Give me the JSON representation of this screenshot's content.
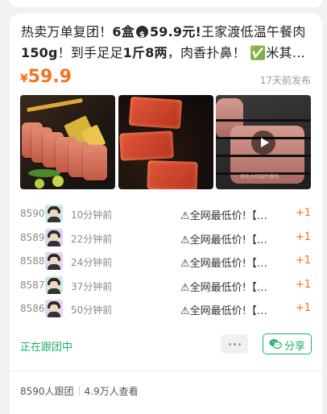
{
  "post": {
    "title_parts": {
      "t1": "热卖万单复团！",
      "t2": "6盒",
      "t3": "59.9元",
      "t4": "!",
      "t5": "王家渡低温午餐肉",
      "t6": "150g",
      "t7": "！到手足足",
      "t8": "1斤8两",
      "t9": "，肉香扑鼻！ ✅米其…"
    },
    "price_symbol": "¥",
    "price_value": "59.9",
    "posted_time": "17天前发布",
    "photos": [
      {
        "name": "luncheon-meat-slices-photo"
      },
      {
        "name": "fried-luncheon-meat-photo"
      },
      {
        "name": "grilled-luncheon-meat-video"
      }
    ],
    "video_watermark": "现在小红园午餐肉"
  },
  "followers": [
    {
      "number": "8590",
      "time": "10分钟前",
      "message": "⚠全网最低价!【…",
      "plus": "+1",
      "avatar_bg": "#cfe9e0"
    },
    {
      "number": "8589",
      "time": "22分钟前",
      "message": "⚠全网最低价!【…",
      "plus": "+1",
      "avatar_bg": "#dcd5ef"
    },
    {
      "number": "8588",
      "time": "24分钟前",
      "message": "⚠全网最低价!【…",
      "plus": "+1",
      "avatar_bg": "#e6d3ec"
    },
    {
      "number": "8587",
      "time": "37分钟前",
      "message": "⚠全网最低价!【…",
      "plus": "+1",
      "avatar_bg": "#cfe9e0"
    },
    {
      "number": "8586",
      "time": "50分钟前",
      "message": "⚠全网最低价!【…",
      "plus": "+1",
      "avatar_bg": "#e6d3ec"
    }
  ],
  "actions": {
    "following_label": "正在跟团中",
    "more_icon": "more-dots-icon",
    "share_label": "分享",
    "share_icon": "wechat-icon"
  },
  "stats": {
    "joined": "8590人跟团",
    "views": "4.9万人查看"
  },
  "colors": {
    "accent_orange": "#f37321",
    "wechat_green": "#23b06a",
    "background": "#f2f2f2"
  }
}
